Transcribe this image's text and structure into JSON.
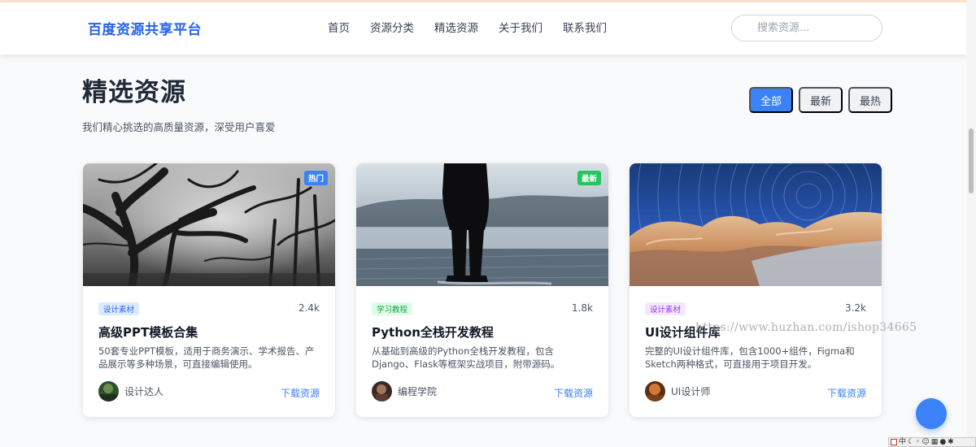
{
  "header": {
    "logo": "百度资源共享平台",
    "nav": [
      "首页",
      "资源分类",
      "精选资源",
      "关于我们",
      "联系我们"
    ],
    "search": {
      "placeholder": "搜索资源...",
      "value": ""
    }
  },
  "section": {
    "title": "精选资源",
    "subtitle": "我们精心挑选的高质量资源，深受用户喜爱",
    "filters": [
      {
        "label": "全部",
        "active": true
      },
      {
        "label": "最新",
        "active": false
      },
      {
        "label": "最热",
        "active": false
      }
    ]
  },
  "cards": [
    {
      "badge": "热门",
      "badge_color": "#3b82f6",
      "tag": "设计素材",
      "tag_bg": "#dbeafe",
      "tag_color": "#2563eb",
      "downloads": "2.4k",
      "title": "高级PPT模板合集",
      "desc": "50套专业PPT模板，适用于商务演示、学术报告、产品展示等多种场景，可直接编辑使用。",
      "author": "设计达人",
      "action": "下载资源",
      "image_icon": "forest-photo"
    },
    {
      "badge": "最新",
      "badge_color": "#22c55e",
      "tag": "学习教程",
      "tag_bg": "#dcfce7",
      "tag_color": "#16a34a",
      "downloads": "1.8k",
      "title": "Python全栈开发教程",
      "desc": "从基础到高级的Python全栈开发教程，包含Django、Flask等框架实战项目，附带源码。",
      "author": "编程学院",
      "action": "下载资源",
      "image_icon": "lake-photo"
    },
    {
      "badge": "",
      "tag": "设计素材",
      "tag_bg": "#f3e8ff",
      "tag_color": "#9333ea",
      "downloads": "3.2k",
      "title": "UI设计组件库",
      "desc": "完整的UI设计组件库，包含1000+组件，Figma和Sketch两种格式，可直接用于项目开发。",
      "author": "UI设计师",
      "action": "下载资源",
      "image_icon": "star-trail-photo"
    }
  ],
  "watermark": "https://www.huzhan.com/ishop34665",
  "ime": [
    "中"
  ],
  "colors": {
    "accent": "#3b82f6",
    "logo": "#2563eb"
  }
}
